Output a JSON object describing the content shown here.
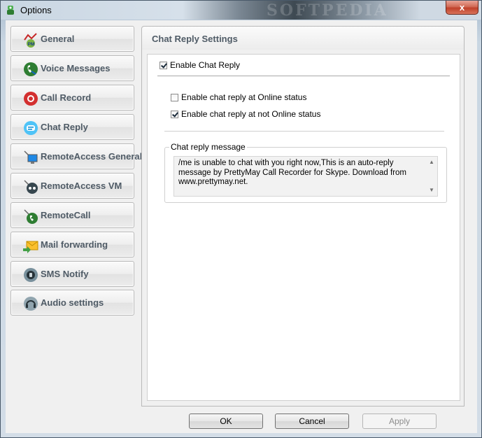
{
  "window": {
    "title": "Options",
    "watermark": "SOFTPEDIA",
    "close_label": "x"
  },
  "sidebar": {
    "items": [
      {
        "label": "General",
        "icon": "pm-icon"
      },
      {
        "label": "Voice Messages",
        "icon": "voice-message-icon"
      },
      {
        "label": "Call Record",
        "icon": "record-icon"
      },
      {
        "label": "Chat Reply",
        "icon": "chat-icon"
      },
      {
        "label": "RemoteAccess General",
        "icon": "remote-computer-icon"
      },
      {
        "label": "RemoteAccess VM",
        "icon": "remote-voicemail-icon"
      },
      {
        "label": "RemoteCall",
        "icon": "remote-call-icon"
      },
      {
        "label": "Mail forwarding",
        "icon": "mail-forward-icon"
      },
      {
        "label": "SMS Notify",
        "icon": "sms-icon"
      },
      {
        "label": "Audio settings",
        "icon": "headset-icon"
      }
    ]
  },
  "panel": {
    "title": "Chat Reply Settings",
    "enable_chat_reply": {
      "label": "Enable Chat Reply",
      "checked": true
    },
    "online": {
      "label": "Enable chat reply at Online status",
      "checked": false
    },
    "not_online": {
      "label": "Enable chat reply at not Online status",
      "checked": true
    },
    "message_group_label": "Chat reply message",
    "message_text": "/me is unable to chat with you right now,This is an auto-reply message by PrettyMay Call Recorder for Skype. Download from www.prettymay.net."
  },
  "buttons": {
    "ok": "OK",
    "cancel": "Cancel",
    "apply": "Apply"
  },
  "colors": {
    "nav_label": "#4f5b66",
    "close_button": "#c0412a"
  }
}
